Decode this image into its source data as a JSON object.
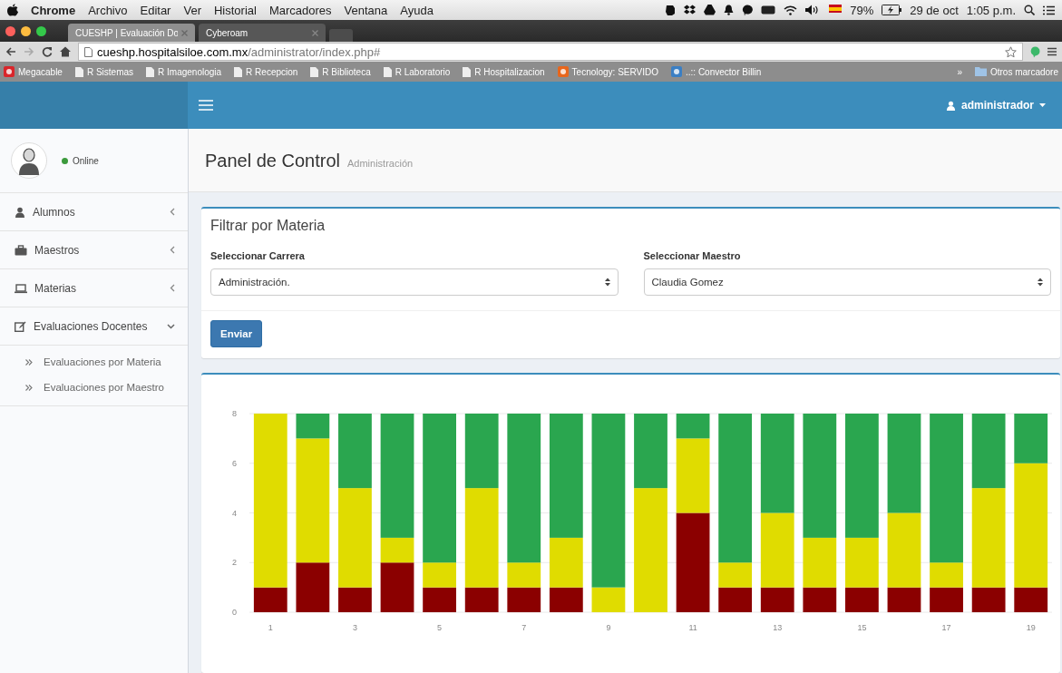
{
  "menu_bar": {
    "app": "Chrome",
    "items": [
      "Archivo",
      "Editar",
      "Ver",
      "Historial",
      "Marcadores",
      "Ventana",
      "Ayuda"
    ],
    "battery": "79%",
    "date": "29 de oct",
    "time": "1:05 p.m."
  },
  "browser": {
    "tabs": [
      {
        "title": "CUESHP | Evaluación Do",
        "selected": true
      },
      {
        "title": "Cyberoam",
        "selected": false
      }
    ],
    "url_host": "cueshp.hospitalsiloe.com.mx",
    "url_path": "/administrator/index.php#",
    "bookmarks": [
      {
        "label": "Megacable",
        "kind": "site"
      },
      {
        "label": "R Sistemas",
        "kind": "page"
      },
      {
        "label": "R Imagenologia",
        "kind": "page"
      },
      {
        "label": "R Recepcion",
        "kind": "page"
      },
      {
        "label": "R Biblioteca",
        "kind": "page"
      },
      {
        "label": "R Laboratorio",
        "kind": "page"
      },
      {
        "label": "R Hospitalizacion",
        "kind": "page"
      },
      {
        "label": "Tecnology: SERVIDO",
        "kind": "site"
      },
      {
        "label": "..:: Convector Billin",
        "kind": "site"
      }
    ],
    "overflow": "»",
    "other_bookmarks": "Otros marcadore"
  },
  "header": {
    "user": "administrador"
  },
  "sidebar": {
    "status": "Online",
    "items": [
      {
        "label": "Alumnos",
        "expanded": false
      },
      {
        "label": "Maestros",
        "expanded": false
      },
      {
        "label": "Materias",
        "expanded": false
      },
      {
        "label": "Evaluaciones Docentes",
        "expanded": true,
        "children": [
          {
            "label": "Evaluaciones por Materia"
          },
          {
            "label": "Evaluaciones por Maestro"
          }
        ]
      }
    ]
  },
  "page": {
    "title": "Panel de Control",
    "subtitle": "Administración"
  },
  "filter": {
    "title": "Filtrar por Materia",
    "fields": [
      {
        "label": "Seleccionar Carrera",
        "value": "Administración."
      },
      {
        "label": "Seleccionar Maestro",
        "value": "Claudia Gomez"
      }
    ],
    "button": "Enviar"
  },
  "chart": {
    "chart_data": {
      "type": "bar",
      "stacked": true,
      "x": [
        1,
        2,
        3,
        4,
        5,
        6,
        7,
        8,
        9,
        10,
        11,
        12,
        13,
        14,
        15,
        16,
        17,
        18,
        19
      ],
      "xlim": [
        0.5,
        19.5
      ],
      "xticks": [
        1,
        3,
        5,
        7,
        9,
        11,
        13,
        15,
        17,
        19
      ],
      "yticks": [
        0,
        2,
        4,
        6,
        8
      ],
      "ylim": [
        0,
        8
      ],
      "grid": true,
      "series": [
        {
          "color": "#8b0000",
          "values": [
            1,
            2,
            1,
            2,
            1,
            1,
            1,
            1,
            0,
            0,
            4,
            1,
            1,
            1,
            1,
            1,
            1,
            1,
            1
          ]
        },
        {
          "color": "#e0dc00",
          "values": [
            7,
            5,
            4,
            1,
            1,
            4,
            1,
            2,
            1,
            5,
            3,
            1,
            3,
            2,
            2,
            3,
            1,
            4,
            5
          ]
        },
        {
          "color": "#2aa64f",
          "values": [
            0,
            1,
            3,
            5,
            6,
            3,
            6,
            5,
            7,
            3,
            1,
            6,
            4,
            5,
            5,
            4,
            6,
            3,
            2
          ]
        }
      ]
    }
  }
}
